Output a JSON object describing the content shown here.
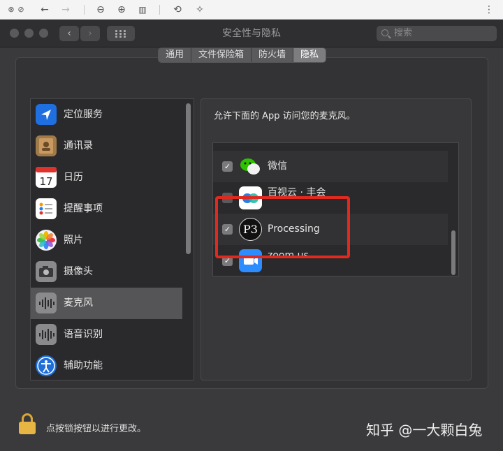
{
  "window": {
    "title": "安全性与隐私",
    "search_placeholder": "搜索"
  },
  "tabs": [
    "通用",
    "文件保险箱",
    "防火墙",
    "隐私"
  ],
  "active_tab": "隐私",
  "sidebar": {
    "items": [
      {
        "label": "定位服务",
        "icon": "location-icon",
        "color": "#1f6fe0"
      },
      {
        "label": "通讯录",
        "icon": "contacts-icon",
        "color": "#a07a48"
      },
      {
        "label": "日历",
        "icon": "calendar-icon",
        "color": "#ffffff"
      },
      {
        "label": "提醒事项",
        "icon": "reminders-icon",
        "color": "#ffffff"
      },
      {
        "label": "照片",
        "icon": "photos-icon",
        "color": "#f2f2f2"
      },
      {
        "label": "摄像头",
        "icon": "camera-icon",
        "color": "#8a8a8c"
      },
      {
        "label": "麦克风",
        "icon": "microphone-icon",
        "color": "#8a8a8c"
      },
      {
        "label": "语音识别",
        "icon": "speech-recognition-icon",
        "color": "#8a8a8c"
      },
      {
        "label": "辅助功能",
        "icon": "accessibility-icon",
        "color": "#1e6fd9"
      }
    ],
    "selected": "麦克风"
  },
  "panel": {
    "caption": "允许下面的 App 访问您的麦克风。",
    "apps": [
      {
        "label": "微信",
        "checked": true,
        "icon": "wechat-icon",
        "color": "#2dc100"
      },
      {
        "label": "百视云 · 丰会",
        "checked": false,
        "icon": "conference-icon",
        "color": "#2a7de1"
      },
      {
        "label": "Processing",
        "checked": true,
        "icon": "processing-icon",
        "color": "#111111"
      },
      {
        "label": "zoom.us",
        "checked": true,
        "icon": "zoom-icon",
        "color": "#2d8cff"
      }
    ]
  },
  "footer": {
    "lock_text": "点按锁按钮以进行更改。"
  },
  "watermark": "知乎 @一大颗白兔",
  "colors": {
    "highlight": "#e02a20",
    "lock": "#e7b544"
  }
}
